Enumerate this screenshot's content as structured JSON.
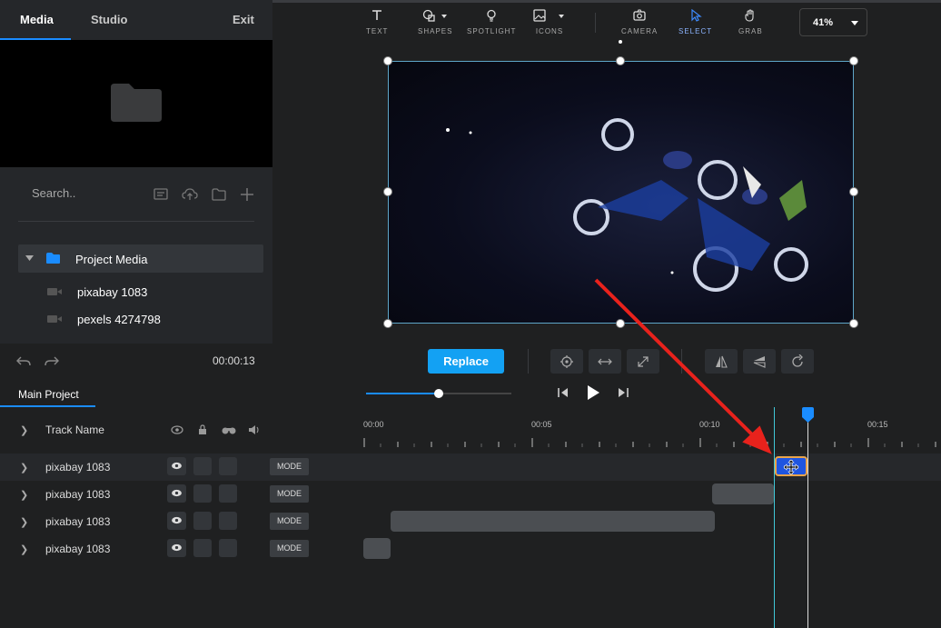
{
  "left_panel": {
    "tabs": [
      "Media",
      "Studio"
    ],
    "exit": "Exit",
    "search_placeholder": "Search..",
    "project_media": "Project Media",
    "media_items": [
      "pixabay 1083",
      "pexels 4274798"
    ],
    "time": "00:00:13"
  },
  "toolbar": {
    "text": "TEXT",
    "shapes": "SHAPES",
    "spotlight": "SPOTLIGHT",
    "icons": "ICONS",
    "camera": "CAMERA",
    "select": "SELECT",
    "grab": "GRAB",
    "zoom": "41%"
  },
  "canvas_toolbar": {
    "replace": "Replace"
  },
  "timeline": {
    "main_project": "Main Project",
    "track_name": "Track Name",
    "ticks": [
      "00:00",
      "00:05",
      "00:10",
      "00:15"
    ],
    "tracks": [
      {
        "label": "pixabay 1083",
        "mode": "MODE"
      },
      {
        "label": "pixabay 1083",
        "mode": "MODE"
      },
      {
        "label": "pixabay 1083",
        "mode": "MODE"
      },
      {
        "label": "pixabay 1083",
        "mode": "MODE"
      }
    ]
  },
  "colors": {
    "accent": "#1a8cff",
    "replace_button": "#13a1f3",
    "annotation_arrow": "#e8221c",
    "selected_clip": "#1f55e0"
  }
}
